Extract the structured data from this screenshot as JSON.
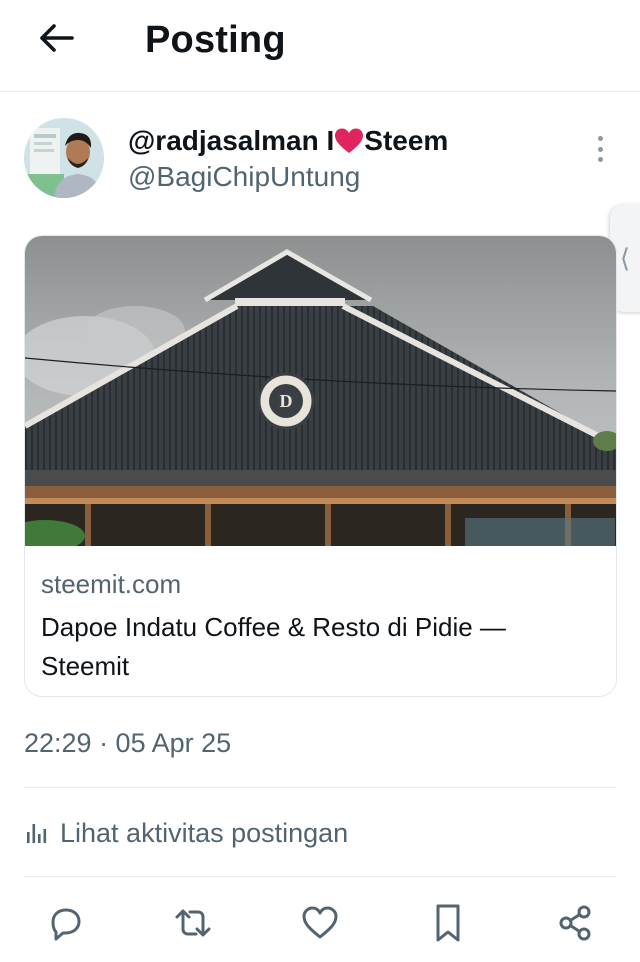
{
  "header": {
    "back_icon": "arrow-left-icon",
    "title": "Posting"
  },
  "author": {
    "display_name_prefix": "@radjasalman I",
    "display_name_heart": "red-heart-emoji",
    "display_name_suffix": "Steem",
    "handle": "@BagiChipUntung",
    "more_icon": "more-vertical-icon"
  },
  "card": {
    "image_icon": "building-photo",
    "domain": "steemit.com",
    "title": "Dapoe Indatu Coffee & Resto di Pidie — Steemit"
  },
  "post": {
    "timestamp": "22:29 · 05 Apr 25"
  },
  "activity": {
    "icon": "bar-chart-icon",
    "label": "Lihat aktivitas postingan"
  },
  "actions": [
    {
      "name": "reply",
      "icon": "reply-icon"
    },
    {
      "name": "repost",
      "icon": "repost-icon"
    },
    {
      "name": "like",
      "icon": "heart-outline-icon"
    },
    {
      "name": "bookmark",
      "icon": "bookmark-icon"
    },
    {
      "name": "share",
      "icon": "share-icon"
    }
  ],
  "colors": {
    "text_primary": "#0f1419",
    "text_secondary": "#536471",
    "divider": "#e6ecf0",
    "heart_red": "#e0245e"
  }
}
